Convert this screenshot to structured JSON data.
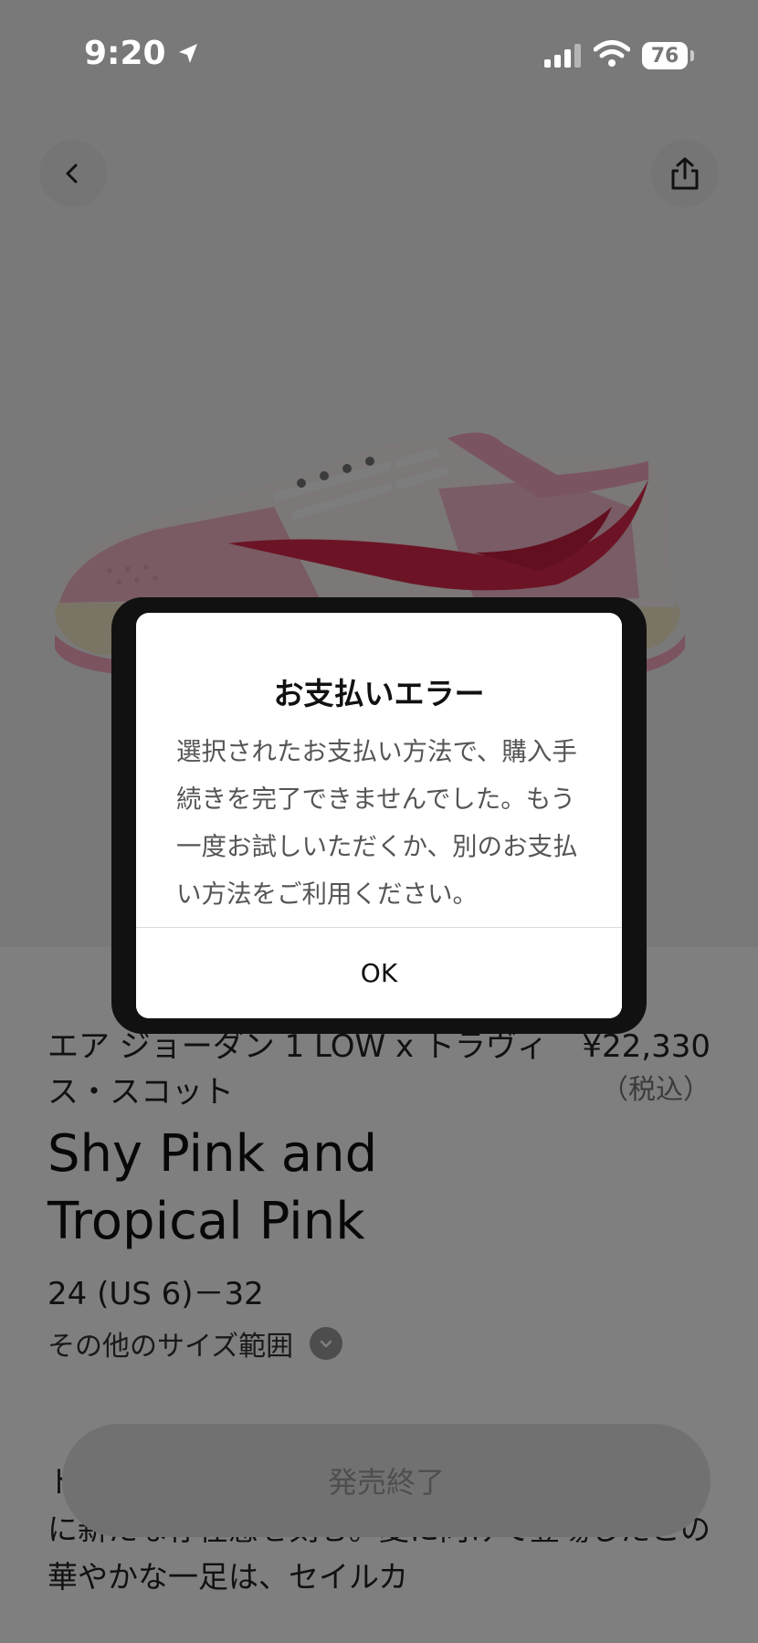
{
  "status_bar": {
    "time": "9:20",
    "battery": "76"
  },
  "product": {
    "type": "エア ジョーダン 1 LOW x トラヴィス・スコット",
    "price": "¥22,330",
    "tax_note": "（税込）",
    "name": "Shy Pink and Tropical Pink",
    "size_range": "24 (US 6)－32",
    "more_sizes_label": "その他のサイズ範囲",
    "description": "トラヴィス・スコットがエア ジョーダン 1 LOWに新たな存在感を刻む。夏に向けて登場したこの華やかな一足は、セイルカ",
    "cta_label": "発売終了"
  },
  "dialog": {
    "title": "お支払いエラー",
    "message": "選択されたお支払い方法で、購入手続きを完了できませんでした。もう一度お試しいただくか、別のお支払い方法をご利用ください。",
    "ok_label": "OK"
  },
  "icons": {
    "back": "chevron-left-icon",
    "share": "share-icon",
    "location": "location-arrow-icon",
    "more_sizes": "chevron-down-icon"
  },
  "colors": {
    "shoe_pink": "#f2b8c6",
    "swoosh_red": "#d8284a",
    "cta_disabled": "#e3e3e3"
  }
}
